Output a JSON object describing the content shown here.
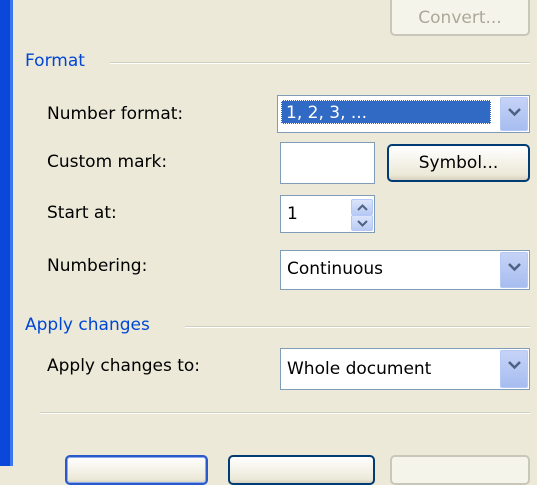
{
  "top": {
    "convert_label": "Convert..."
  },
  "format": {
    "title": "Format",
    "number_format_label": "Number format:",
    "number_format_value": "1, 2, 3, ...",
    "custom_mark_label": "Custom mark:",
    "custom_mark_value": "",
    "symbol_label": "Symbol...",
    "start_at_label": "Start at:",
    "start_at_value": "1",
    "numbering_label": "Numbering:",
    "numbering_value": "Continuous"
  },
  "apply": {
    "title": "Apply changes",
    "apply_to_label": "Apply changes to:",
    "apply_to_value": "Whole document"
  },
  "icons": {
    "dropdown": "chevron-down-icon",
    "spin_up": "spin-up-icon",
    "spin_down": "spin-down-icon"
  },
  "colors": {
    "accent": "#0046d5",
    "selection": "#316ac5",
    "dialog_bg": "#ece9d8"
  }
}
